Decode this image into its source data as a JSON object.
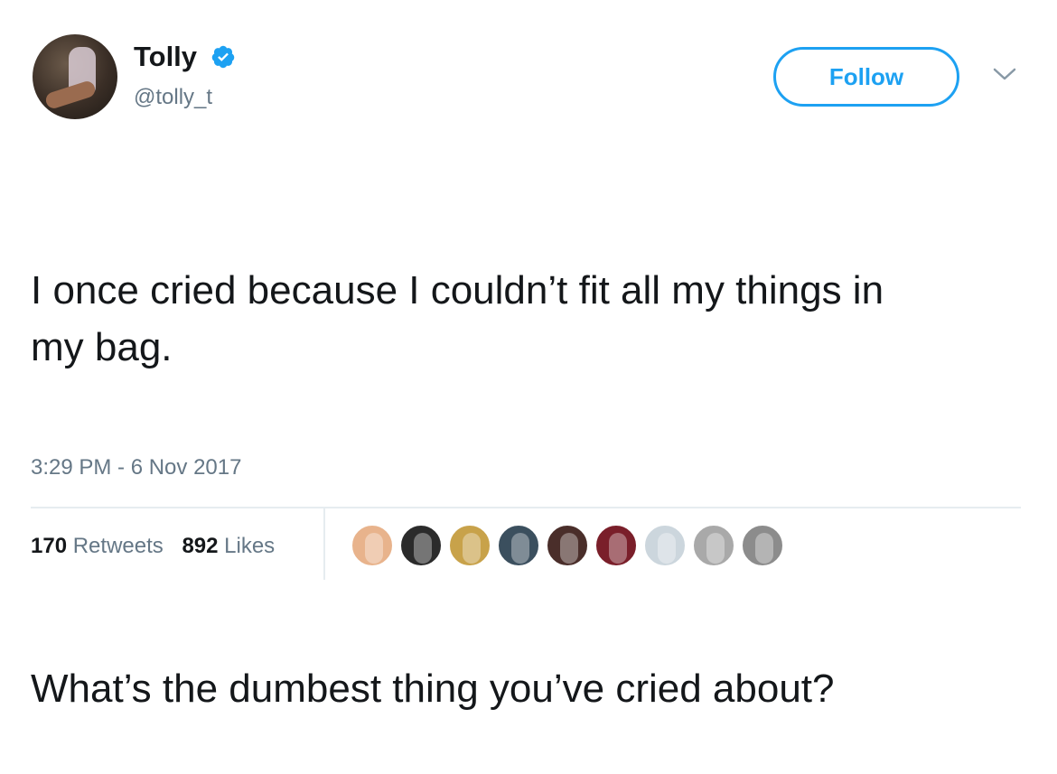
{
  "user": {
    "name": "Tolly",
    "handle": "@tolly_t",
    "verified": true
  },
  "follow_button": {
    "label": "Follow"
  },
  "tweet": {
    "paragraphs": [
      "I once cried because I couldn’t fit all my things in my bag.",
      "What’s the dumbest thing you’ve cried about?"
    ],
    "timestamp": "3:29 PM - 6 Nov 2017"
  },
  "stats": {
    "retweets_count": "170",
    "retweets_label": "Retweets",
    "likes_count": "892",
    "likes_label": "Likes"
  },
  "liker_avatars": [
    {
      "color": "#e8b38c"
    },
    {
      "color": "#2b2b2b"
    },
    {
      "color": "#c8a24a"
    },
    {
      "color": "#3b4f5e"
    },
    {
      "color": "#4a2e2a"
    },
    {
      "color": "#7a1f2a"
    },
    {
      "color": "#ccd6dd"
    },
    {
      "color": "#a9a9a9"
    },
    {
      "color": "#8c8c8c"
    }
  ],
  "colors": {
    "accent": "#1da1f2",
    "text": "#14171a",
    "muted": "#657786",
    "divider": "#e6ecf0"
  }
}
